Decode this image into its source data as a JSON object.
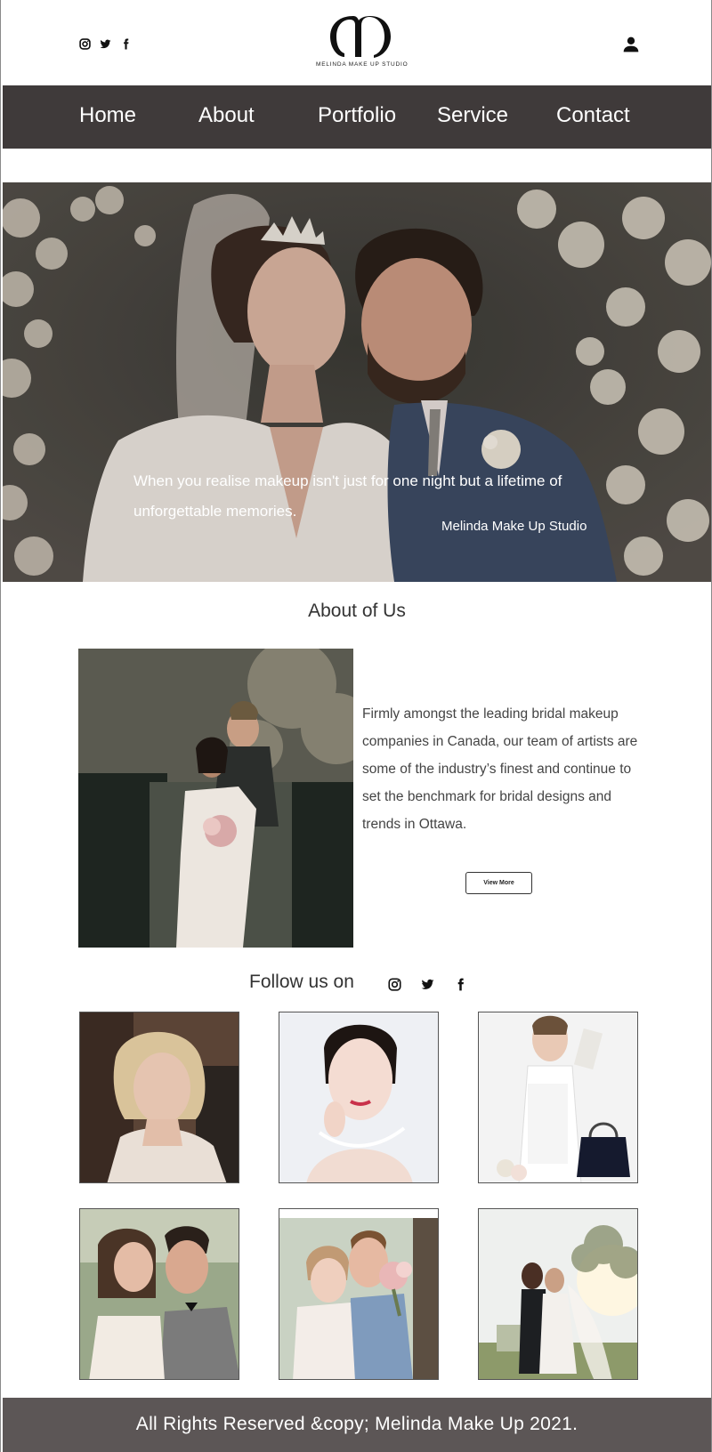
{
  "header": {
    "logo_text": "MELINDA MAKE UP STUDIO",
    "social_icons": [
      "instagram-icon",
      "twitter-icon",
      "facebook-icon"
    ],
    "account_icon": "user-icon"
  },
  "nav": {
    "items": [
      "Home",
      "About",
      "Portfolio",
      "Service",
      "Contact"
    ],
    "background": "#3f3a3a"
  },
  "hero": {
    "image": "bride-and-groom-photo",
    "quote": "When you realise makeup isn't just for one night but a lifetime of unforgettable memories.",
    "signature": "Melinda Make Up Studio"
  },
  "about": {
    "title": "About of Us",
    "image": "couple-embracing-photo",
    "text": "Firmly amongst the leading bridal makeup companies in Canada, our team of artists are some of the industry’s finest and continue to set the benchmark for bridal designs and trends in Ottawa.",
    "button_label": "View More"
  },
  "follow": {
    "title": "Follow us on",
    "icons": [
      "instagram-icon",
      "twitter-icon",
      "facebook-icon"
    ]
  },
  "gallery": {
    "items": [
      "blonde-bride-portrait",
      "makeup-model-portrait",
      "fashion-model-with-handbag",
      "wedding-couple-kissing",
      "couple-with-bouquet",
      "couple-at-sunset"
    ]
  },
  "footer": {
    "text": "All Rights Reserved &copy; Melinda Make Up 2021.",
    "background": "#5c5656"
  }
}
